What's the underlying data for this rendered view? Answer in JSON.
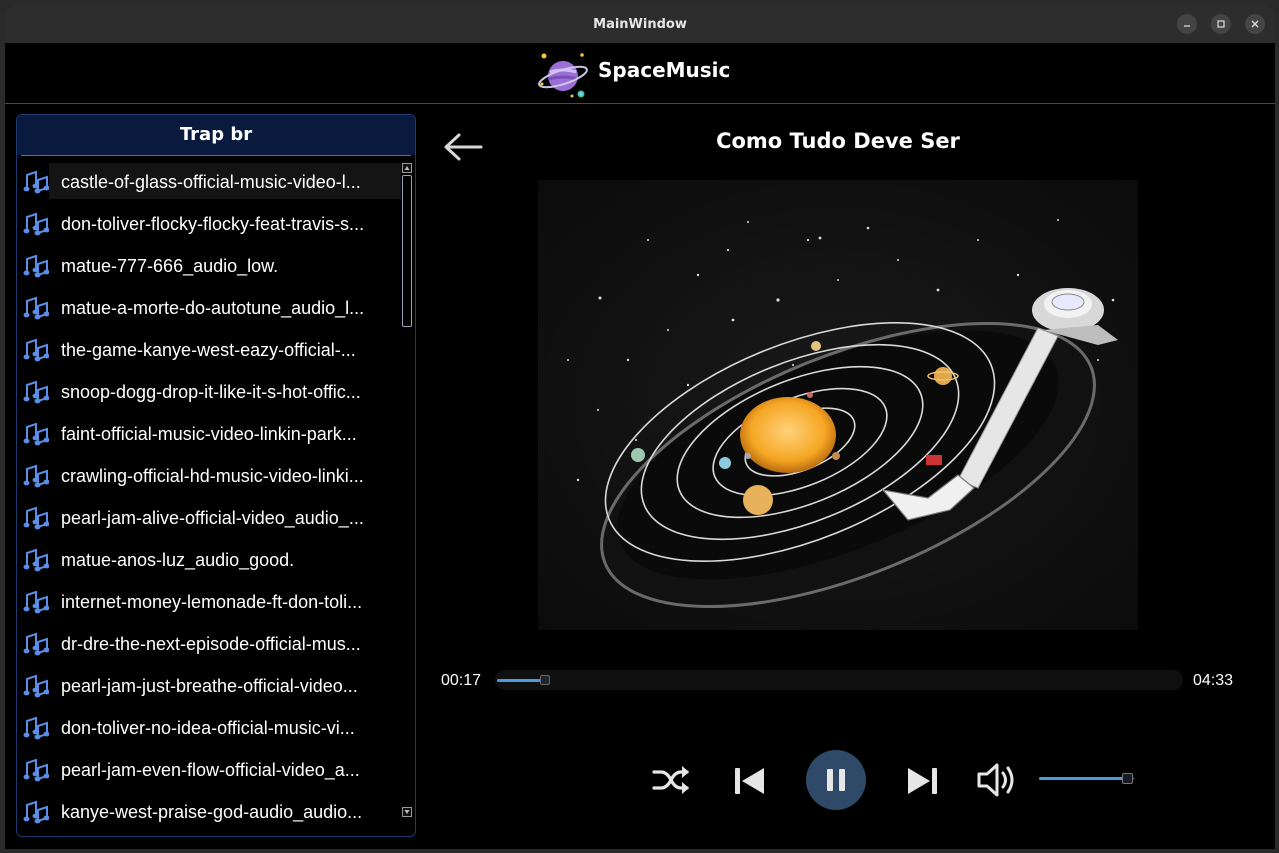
{
  "window": {
    "title": "MainWindow"
  },
  "window_controls": [
    "minimize-icon",
    "maximize-icon",
    "close-icon"
  ],
  "app": {
    "name": "SpaceMusic"
  },
  "playlist": {
    "title": "Trap br",
    "tracks": [
      "castle-of-glass-official-music-video-l...",
      "don-toliver-flocky-flocky-feat-travis-s...",
      "matue-777-666_audio_low.",
      "matue-a-morte-do-autotune_audio_l...",
      "the-game-kanye-west-eazy-official-...",
      "snoop-dogg-drop-it-like-it-s-hot-offic...",
      "faint-official-music-video-linkin-park...",
      "crawling-official-hd-music-video-linki...",
      "pearl-jam-alive-official-video_audio_...",
      "matue-anos-luz_audio_good.",
      "internet-money-lemonade-ft-don-toli...",
      "dr-dre-the-next-episode-official-mus...",
      "pearl-jam-just-breathe-official-video...",
      "don-toliver-no-idea-official-music-vi...",
      "pearl-jam-even-flow-official-video_a...",
      "kanye-west-praise-god-audio_audio..."
    ],
    "selected_index": 0
  },
  "player": {
    "song_title": "Como Tudo Deve Ser",
    "current_time": "00:17",
    "total_time": "04:33",
    "progress_fraction": 0.065,
    "volume_fraction": 0.92,
    "state": "playing"
  },
  "colors": {
    "accent": "#4b9be0",
    "play_button": "#2f4a68",
    "playlist_header": "#0a1a3e",
    "background": "#000000"
  }
}
